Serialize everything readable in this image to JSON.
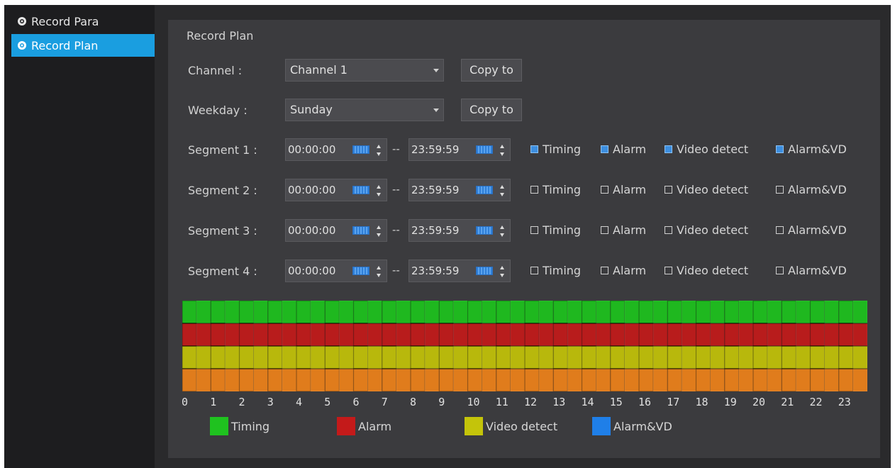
{
  "sidebar": {
    "items": [
      {
        "label": "Record Para",
        "icon": "gear-icon",
        "active": false
      },
      {
        "label": "Record Plan",
        "icon": "gear-icon",
        "active": true
      }
    ]
  },
  "panel": {
    "title": "Record Plan",
    "channel": {
      "label": "Channel :",
      "value": "Channel 1",
      "copy_label": "Copy to"
    },
    "weekday": {
      "label": "Weekday :",
      "value": "Sunday",
      "copy_label": "Copy to"
    },
    "segments": [
      {
        "label": "Segment 1 :",
        "start": "00:00:00",
        "end": "23:59:59",
        "timing": true,
        "alarm": true,
        "video_detect": true,
        "alarm_vd": true
      },
      {
        "label": "Segment 2 :",
        "start": "00:00:00",
        "end": "23:59:59",
        "timing": false,
        "alarm": false,
        "video_detect": false,
        "alarm_vd": false
      },
      {
        "label": "Segment 3 :",
        "start": "00:00:00",
        "end": "23:59:59",
        "timing": false,
        "alarm": false,
        "video_detect": false,
        "alarm_vd": false
      },
      {
        "label": "Segment 4 :",
        "start": "00:00:00",
        "end": "23:59:59",
        "timing": false,
        "alarm": false,
        "video_detect": false,
        "alarm_vd": false
      }
    ],
    "checkbox_labels": {
      "timing": "Timing",
      "alarm": "Alarm",
      "video_detect": "Video detect",
      "alarm_vd": "Alarm&VD"
    },
    "time_separator": "--"
  },
  "schedule": {
    "hours": [
      "0",
      "1",
      "2",
      "3",
      "4",
      "5",
      "6",
      "7",
      "8",
      "9",
      "10",
      "11",
      "12",
      "13",
      "14",
      "15",
      "16",
      "17",
      "18",
      "19",
      "20",
      "21",
      "22",
      "23"
    ],
    "rows": [
      {
        "name": "Timing",
        "color": "#1fb81f",
        "full_day": true
      },
      {
        "name": "Alarm",
        "color": "#b81c1c",
        "full_day": true
      },
      {
        "name": "Video detect",
        "color": "#b8b80c",
        "full_day": true
      },
      {
        "name": "Alarm&VD",
        "color": "#e07c1c",
        "full_day": true
      }
    ]
  },
  "legend": [
    {
      "label": "Timing",
      "color": "#1fc21f"
    },
    {
      "label": "Alarm",
      "color": "#c41a1a"
    },
    {
      "label": "Video detect",
      "color": "#c4c40a"
    },
    {
      "label": "Alarm&VD",
      "color": "#1f7fe8"
    }
  ]
}
